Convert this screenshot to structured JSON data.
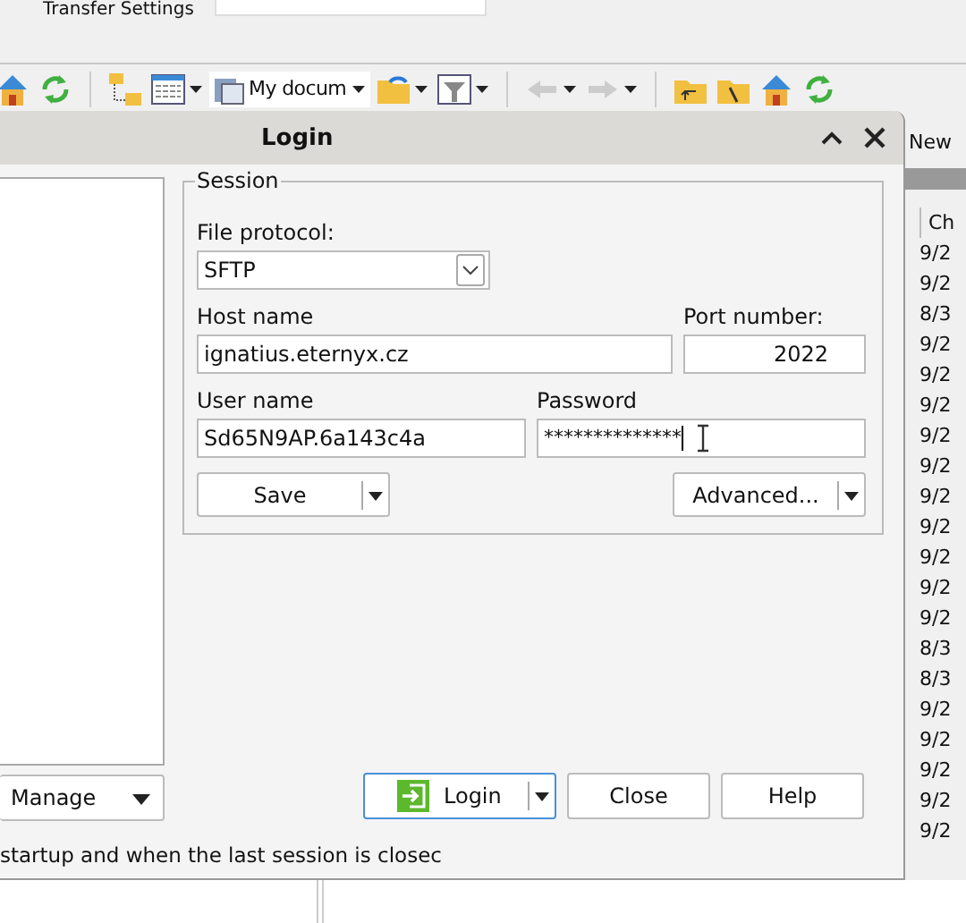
{
  "top_strip": {
    "label": "Transfer Settings"
  },
  "toolbar": {
    "location": "My docum"
  },
  "dialog": {
    "title": "Login",
    "session": {
      "legend": "Session",
      "file_protocol": {
        "label": "File protocol:",
        "value": "SFTP"
      },
      "host": {
        "label": "Host name",
        "value": "ignatius.eternyx.cz"
      },
      "port": {
        "label": "Port number:",
        "value": "2022"
      },
      "user": {
        "label": "User name",
        "value": "Sd65N9AP.6a143c4a"
      },
      "password": {
        "label": "Password",
        "value": "**************"
      },
      "buttons": [
        "Save",
        "Advanced..."
      ]
    },
    "manage": "Manage",
    "buttons": [
      {
        "label": "Login",
        "kind": "primary"
      },
      {
        "label": "Close",
        "kind": "plain"
      },
      {
        "label": "Help",
        "kind": "plain"
      }
    ],
    "status": "startup and when the last session is closec"
  },
  "background_panel": {
    "tab": "New",
    "column_header": "Ch",
    "rows": [
      "9/2",
      "9/2",
      "8/3",
      "9/2",
      "9/2",
      "9/2",
      "9/2",
      "9/2",
      "9/2",
      "9/2",
      "9/2",
      "9/2",
      "9/2",
      "8/3",
      "8/3",
      "9/2",
      "9/2",
      "9/2",
      "9/2",
      "9/2"
    ]
  }
}
